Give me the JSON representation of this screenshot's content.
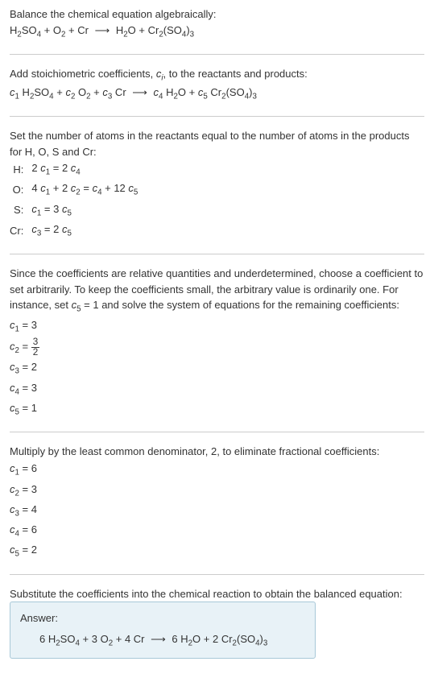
{
  "step1": {
    "text": "Balance the chemical equation algebraically:"
  },
  "step2": {
    "text_before": "Add stoichiometric coefficients, ",
    "ci": "c",
    "ci_sub": "i",
    "text_after": ", to the reactants and products:"
  },
  "step3": {
    "text": "Set the number of atoms in the reactants equal to the number of atoms in the products for H, O, S and Cr:",
    "rows": [
      {
        "label": "H:"
      },
      {
        "label": "O:"
      },
      {
        "label": "S:"
      },
      {
        "label": "Cr:"
      }
    ]
  },
  "step4": {
    "text_before": "Since the coefficients are relative quantities and underdetermined, choose a coefficient to set arbitrarily. To keep the coefficients small, the arbitrary value is ordinarily one. For instance, set ",
    "text_after": " = 1 and solve the system of equations for the remaining coefficients:"
  },
  "step5": {
    "text": "Multiply by the least common denominator, 2, to eliminate fractional coefficients:"
  },
  "step6": {
    "text": "Substitute the coefficients into the chemical reaction to obtain the balanced equation:"
  },
  "answer": {
    "label": "Answer:"
  },
  "chart_data": {
    "type": "table",
    "unbalanced_equation": "H2SO4 + O2 + Cr -> H2O + Cr2(SO4)3",
    "stoich_equation": "c1 H2SO4 + c2 O2 + c3 Cr -> c4 H2O + c5 Cr2(SO4)3",
    "atom_equations": [
      {
        "element": "H",
        "equation": "2 c1 = 2 c4"
      },
      {
        "element": "O",
        "equation": "4 c1 + 2 c2 = c4 + 12 c5"
      },
      {
        "element": "S",
        "equation": "c1 = 3 c5"
      },
      {
        "element": "Cr",
        "equation": "c3 = 2 c5"
      }
    ],
    "set_coefficient": "c5 = 1",
    "initial_coefficients": {
      "c1": "3",
      "c2": "3/2",
      "c3": "2",
      "c4": "3",
      "c5": "1"
    },
    "lcm": 2,
    "final_coefficients": {
      "c1": "6",
      "c2": "3",
      "c3": "4",
      "c4": "6",
      "c5": "2"
    },
    "balanced_equation": "6 H2SO4 + 3 O2 + 4 Cr -> 6 H2O + 2 Cr2(SO4)3"
  }
}
